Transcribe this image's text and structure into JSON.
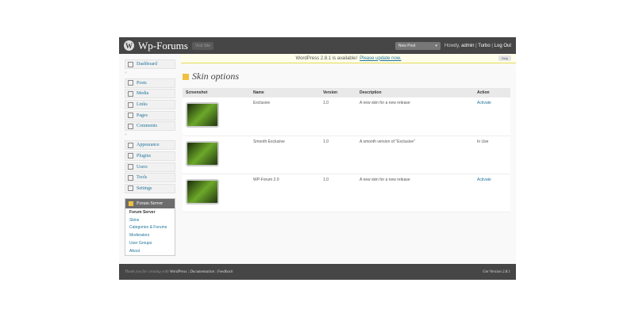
{
  "header": {
    "logo": "W",
    "site": "Wp-Forums",
    "visit_site": "Visit Site",
    "new_post": "New Post",
    "howdy": "Howdy,",
    "user": "admin",
    "turbo": "Turbo",
    "logout": "Log Out"
  },
  "update": {
    "text": "WordPress 2.8.1 is available!",
    "link": "Please update now.",
    "help": "Help"
  },
  "sidebar": {
    "items": [
      "Dashboard",
      "Posts",
      "Media",
      "Links",
      "Pages",
      "Comments",
      "Appearance",
      "Plugins",
      "Users",
      "Tools",
      "Settings"
    ],
    "forum": {
      "title": "Forum Server",
      "items": [
        "Forum Server",
        "Skins",
        "Categories & Forums",
        "Moderators",
        "User Groups",
        "About"
      ]
    }
  },
  "page": {
    "title": "Skin options"
  },
  "table": {
    "headers": [
      "Screenshot",
      "Name",
      "Version",
      "Description",
      "Action"
    ],
    "rows": [
      {
        "name": "Exclusive",
        "version": "1.0",
        "description": "A new skin for a new release",
        "action": "Activate"
      },
      {
        "name": "Smooth Exclusive",
        "version": "1.0",
        "description": "A smooth version of \"Exclusive\"",
        "action": "In Use"
      },
      {
        "name": "WP-Forum 2.0",
        "version": "1.0",
        "description": "A new skin for a new release",
        "action": "Activate"
      }
    ]
  },
  "footer": {
    "thanks": "Thank you for creating with",
    "wp": "WordPress",
    "docs": "Documentation",
    "feedback": "Feedback",
    "version": "Get Version 2.8.1"
  }
}
